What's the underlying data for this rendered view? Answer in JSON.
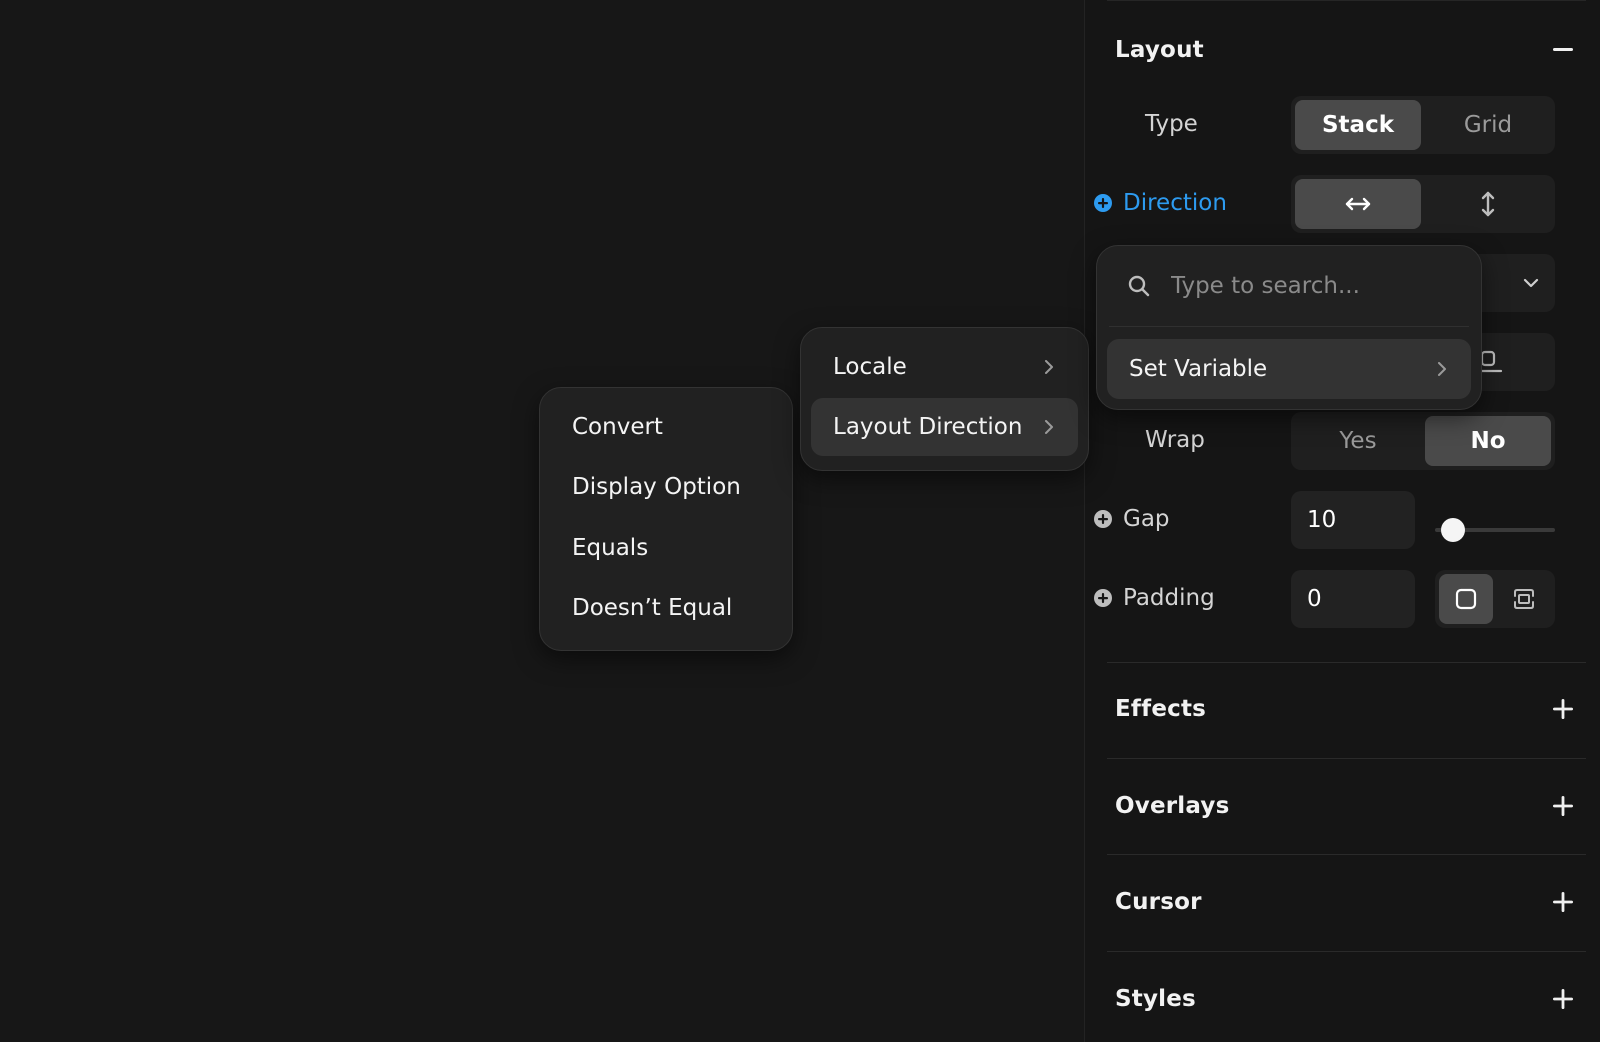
{
  "panel": {
    "layout": {
      "title": "Layout",
      "collapse_icon": "minus-icon",
      "type": {
        "label": "Type",
        "options": [
          "Stack",
          "Grid"
        ],
        "selected": "Stack"
      },
      "direction": {
        "label": "Direction",
        "options_icons": [
          "horizontal-arrows-icon",
          "vertical-arrows-icon"
        ],
        "selected": "horizontal"
      },
      "wrap": {
        "label": "Wrap",
        "options": [
          "Yes",
          "No"
        ],
        "selected": "No"
      },
      "gap": {
        "label": "Gap",
        "value": "10",
        "slider_fraction": 0.1
      },
      "padding": {
        "label": "Padding",
        "value": "0",
        "mode_icons": [
          "uniform-padding-icon",
          "per-side-padding-icon"
        ]
      }
    },
    "sections": [
      {
        "title": "Effects",
        "icon": "plus-icon"
      },
      {
        "title": "Overlays",
        "icon": "plus-icon"
      },
      {
        "title": "Cursor",
        "icon": "plus-icon"
      },
      {
        "title": "Styles",
        "icon": "plus-icon"
      }
    ]
  },
  "menus": {
    "primary": {
      "items": [
        "Convert",
        "Display Option",
        "Equals",
        "Doesn’t Equal"
      ]
    },
    "secondary": {
      "items": [
        "Locale",
        "Layout Direction"
      ],
      "highlighted": "Layout Direction"
    },
    "search": {
      "placeholder": "Type to search...",
      "items": [
        "Set Variable"
      ]
    }
  },
  "colors": {
    "accent": "#2d9bf0",
    "background": "#171717",
    "menu": "#212121",
    "active_segment": "#4a4a4a"
  }
}
